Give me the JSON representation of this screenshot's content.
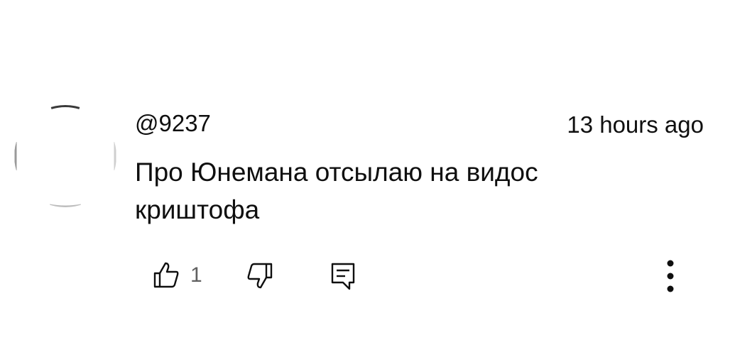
{
  "comment": {
    "author": "@9237",
    "timestamp": "13 hours ago",
    "text": "Про Юнемана отсылаю на видос\nкриштофа",
    "like_count": "1"
  },
  "icons": {
    "avatar": "avatar-image",
    "like": "thumbs-up-icon",
    "dislike": "thumbs-down-icon",
    "reply": "reply-comment-icon",
    "more": "vertical-ellipsis-icon"
  },
  "colors": {
    "text": "#0f0f0f",
    "secondary_text": "#606060",
    "icon": "#0f0f0f"
  }
}
